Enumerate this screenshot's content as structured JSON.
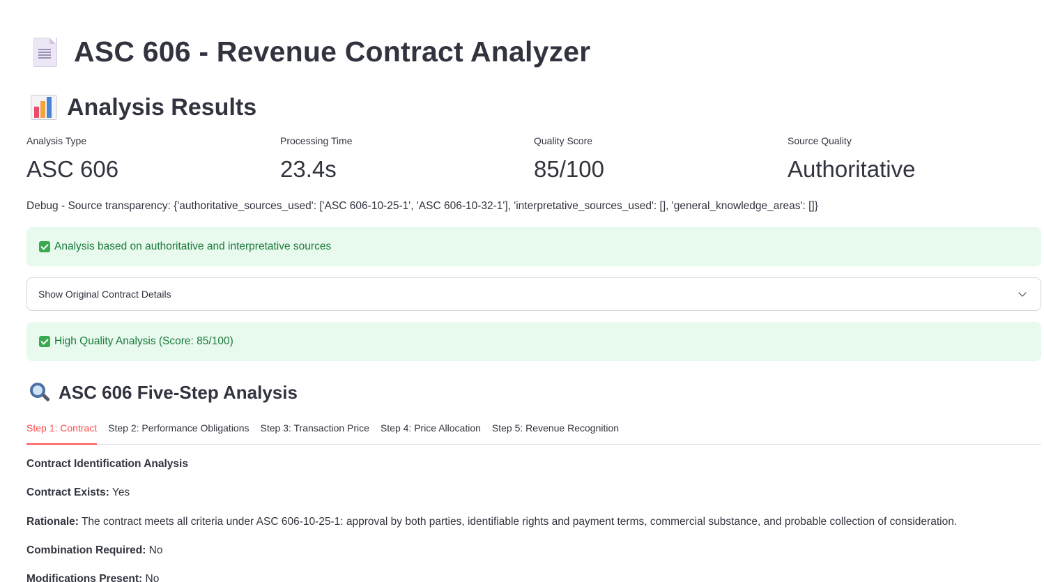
{
  "app": {
    "title": "ASC 606 - Revenue Contract Analyzer",
    "title_icon": "document-icon"
  },
  "results": {
    "heading": "Analysis Results",
    "heading_icon": "bar-chart-icon"
  },
  "metrics": [
    {
      "label": "Analysis Type",
      "value": "ASC 606"
    },
    {
      "label": "Processing Time",
      "value": "23.4s"
    },
    {
      "label": "Quality Score",
      "value": "85/100"
    },
    {
      "label": "Source Quality",
      "value": "Authoritative"
    }
  ],
  "debug_text": "Debug - Source transparency: {'authoritative_sources_used': ['ASC 606-10-25-1', 'ASC 606-10-32-1'], 'interpretative_sources_used': [], 'general_knowledge_areas': []}",
  "alerts": {
    "sources": "Analysis based on authoritative and interpretative sources",
    "quality": "High Quality Analysis (Score: 85/100)"
  },
  "expander": {
    "label": "Show Original Contract Details",
    "expanded": false
  },
  "five_step": {
    "heading": "ASC 606 Five-Step Analysis",
    "heading_icon": "magnifier-icon",
    "tabs": [
      "Step 1: Contract",
      "Step 2: Performance Obligations",
      "Step 3: Transaction Price",
      "Step 4: Price Allocation",
      "Step 5: Revenue Recognition"
    ],
    "active_tab": 0
  },
  "contract": {
    "heading": "Contract Identification Analysis",
    "exists_label": "Contract Exists:",
    "exists_value": " Yes",
    "rationale_label": "Rationale:",
    "rationale_value": " The contract meets all criteria under ASC 606-10-25-1: approval by both parties, identifiable rights and payment terms, commercial substance, and probable collection of consideration.",
    "combination_label": "Combination Required:",
    "combination_value": " No",
    "modifications_label": "Modifications Present:",
    "modifications_value": " No"
  },
  "colors": {
    "accent": "#ff4b4b",
    "success_bg": "#e8f9ee",
    "success_text": "#1a7a3a",
    "text": "#31333f"
  }
}
